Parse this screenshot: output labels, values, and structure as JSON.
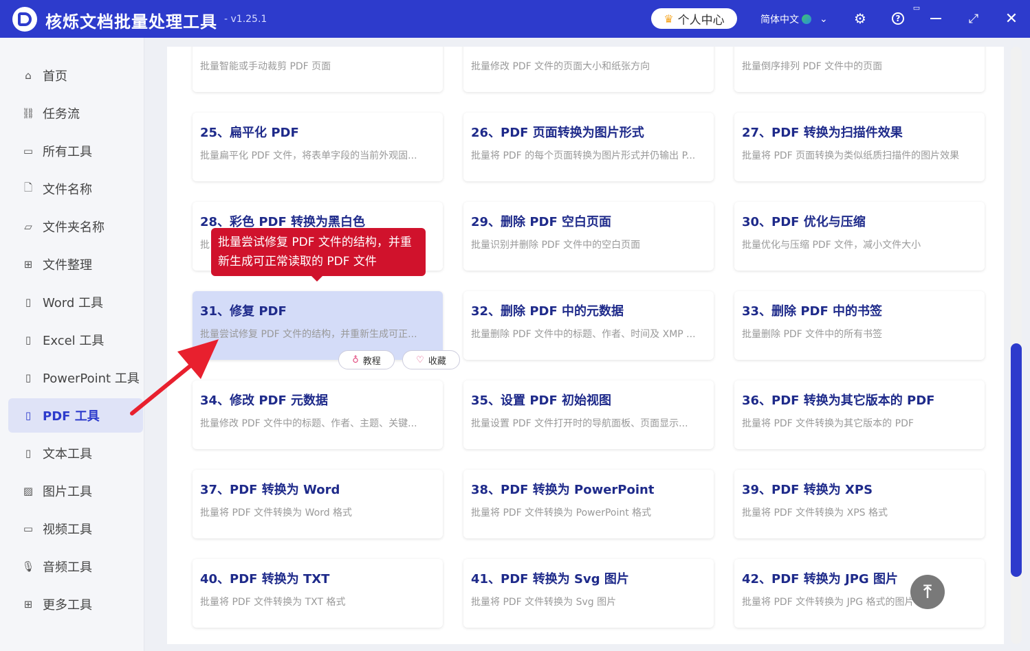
{
  "app": {
    "title": "核烁文档批量处理工具",
    "version": "- v1.25.1",
    "user_center": "个人中心",
    "language": "简体中文"
  },
  "sidebar": {
    "items": [
      {
        "label": "首页",
        "icon": "home-icon"
      },
      {
        "label": "任务流",
        "icon": "workflow-icon"
      },
      {
        "label": "所有工具",
        "icon": "monitor-icon"
      },
      {
        "label": "文件名称",
        "icon": "file-icon"
      },
      {
        "label": "文件夹名称",
        "icon": "folder-icon"
      },
      {
        "label": "文件整理",
        "icon": "organize-icon"
      },
      {
        "label": "Word 工具",
        "icon": "word-icon"
      },
      {
        "label": "Excel 工具",
        "icon": "excel-icon"
      },
      {
        "label": "PowerPoint 工具",
        "icon": "powerpoint-icon"
      },
      {
        "label": "PDF 工具",
        "icon": "pdf-icon"
      },
      {
        "label": "文本工具",
        "icon": "text-icon"
      },
      {
        "label": "图片工具",
        "icon": "image-icon"
      },
      {
        "label": "视频工具",
        "icon": "video-icon"
      },
      {
        "label": "音频工具",
        "icon": "audio-icon"
      },
      {
        "label": "更多工具",
        "icon": "grid-icon"
      }
    ],
    "active": "PDF 工具"
  },
  "cards": [
    {
      "title": "",
      "desc": "批量智能或手动裁剪 PDF 页面"
    },
    {
      "title": "",
      "desc": "批量修改 PDF 文件的页面大小和纸张方向"
    },
    {
      "title": "",
      "desc": "批量倒序排列 PDF 文件中的页面"
    },
    {
      "title": "25、扁平化 PDF",
      "desc": "批量扁平化 PDF 文件，将表单字段的当前外观固..."
    },
    {
      "title": "26、PDF 页面转换为图片形式",
      "desc": "批量将 PDF 的每个页面转换为图片形式并仍输出 P..."
    },
    {
      "title": "27、PDF 转换为扫描件效果",
      "desc": "批量将 PDF 页面转换为类似纸质扫描件的图片效果"
    },
    {
      "title": "28、彩色 PDF 转换为黑白色",
      "desc": "批"
    },
    {
      "title": "29、删除 PDF 空白页面",
      "desc": "批量识别并删除 PDF 文件中的空白页面"
    },
    {
      "title": "30、PDF 优化与压缩",
      "desc": "批量优化与压缩 PDF 文件，减小文件大小"
    },
    {
      "title": "31、修复 PDF",
      "desc": "批量尝试修复 PDF 文件的结构，并重新生成可正..."
    },
    {
      "title": "32、删除 PDF 中的元数据",
      "desc": "批量删除 PDF 文件中的标题、作者、时间及 XMP ..."
    },
    {
      "title": "33、删除 PDF 中的书签",
      "desc": "批量删除 PDF 文件中的所有书签"
    },
    {
      "title": "34、修改 PDF 元数据",
      "desc": "批量修改 PDF 文件中的标题、作者、主题、关键..."
    },
    {
      "title": "35、设置 PDF 初始视图",
      "desc": "批量设置 PDF 文件打开时的导航面板、页面显示..."
    },
    {
      "title": "36、PDF 转换为其它版本的 PDF",
      "desc": "批量将 PDF 文件转换为其它版本的 PDF"
    },
    {
      "title": "37、PDF 转换为 Word",
      "desc": "批量将 PDF 文件转换为 Word 格式"
    },
    {
      "title": "38、PDF 转换为 PowerPoint",
      "desc": "批量将 PDF 文件转换为 PowerPoint 格式"
    },
    {
      "title": "39、PDF 转换为 XPS",
      "desc": "批量将 PDF 文件转换为 XPS 格式"
    },
    {
      "title": "40、PDF 转换为 TXT",
      "desc": "批量将 PDF 文件转换为 TXT 格式"
    },
    {
      "title": "41、PDF 转换为 Svg 图片",
      "desc": "批量将 PDF 文件转换为 Svg 图片"
    },
    {
      "title": "42、PDF 转换为 JPG 图片",
      "desc": "批量将 PDF 文件转换为 JPG 格式的图片"
    }
  ],
  "hover_actions": {
    "tutorial": "教程",
    "favorite": "收藏"
  },
  "tooltip": {
    "line1": "批量尝试修复 PDF 文件的结构，并重",
    "line2": "新生成可正常读取的 PDF 文件"
  },
  "colors": {
    "brand": "#2d3bcc",
    "tooltip": "#d0122c",
    "card_title": "#1e2a8a",
    "hover_card": "#d4dcf8",
    "arrow": "#e8202e"
  }
}
